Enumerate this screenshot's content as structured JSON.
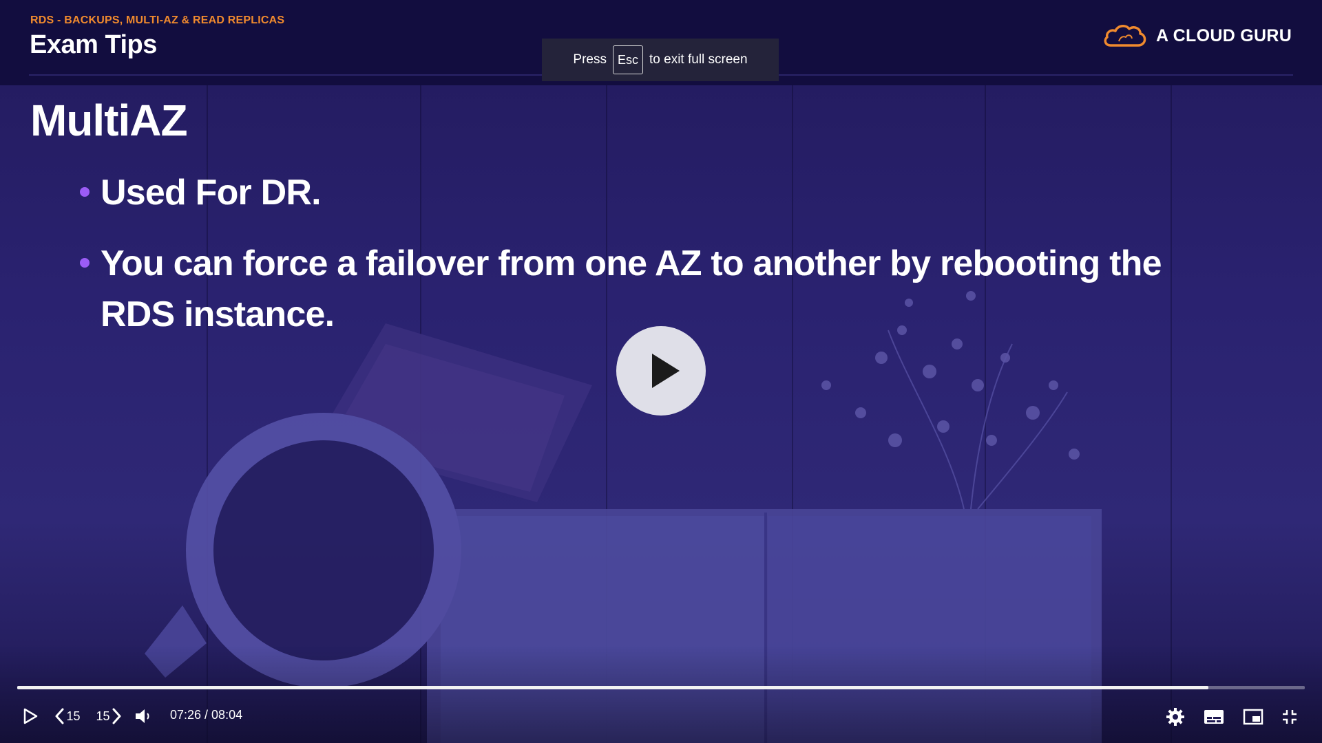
{
  "header": {
    "breadcrumb": "RDS - BACKUPS, MULTI-AZ & READ REPLICAS",
    "title": "Exam Tips"
  },
  "brand": {
    "name": "A CLOUD GURU",
    "icon": "cloud-logo-icon"
  },
  "fullscreen_toast": {
    "prefix": "Press",
    "key": "Esc",
    "suffix": "to exit full screen"
  },
  "slide": {
    "title": "MultiAZ",
    "bullets": [
      "Used For DR.",
      "You can force a failover from one AZ to another by rebooting the RDS instance."
    ]
  },
  "player": {
    "big_play_icon": "play-icon",
    "progress": 0.925,
    "skip_back_label": "15",
    "skip_forward_label": "15",
    "current_time": "07:26",
    "duration": "08:04",
    "time_display": "07:26 / 08:04",
    "icons": {
      "play": "play-icon",
      "skip_back": "chevron-left-icon",
      "skip_forward": "chevron-right-icon",
      "volume": "volume-icon",
      "settings": "gear-icon",
      "captions": "captions-icon",
      "pip": "picture-in-picture-icon",
      "exit_fullscreen": "exit-fullscreen-icon"
    }
  },
  "colors": {
    "header_bg": "#120d3f",
    "accent_orange": "#f08a2e",
    "bullet_purple": "#9b5cf6",
    "overlay_purple": "#2a2270"
  }
}
